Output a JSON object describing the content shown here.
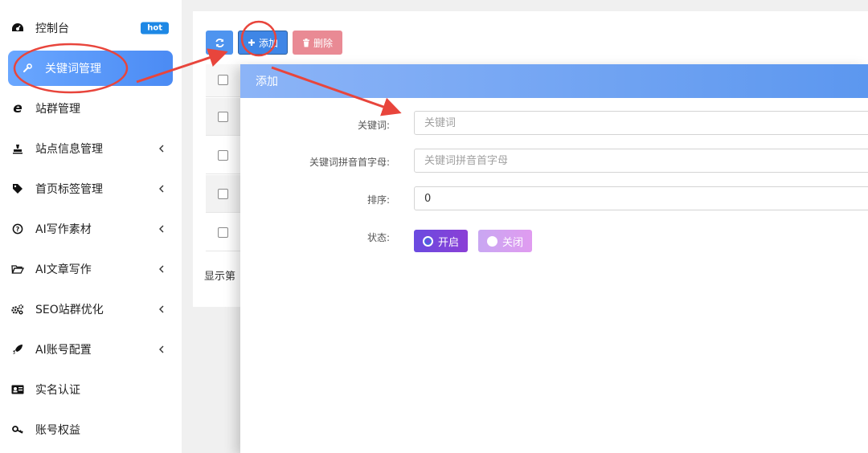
{
  "sidebar": {
    "items": [
      {
        "label": "控制台",
        "icon": "dashboard-icon",
        "badge": "hot"
      },
      {
        "label": "关键词管理",
        "icon": "wrench-icon",
        "active": true
      },
      {
        "label": "站群管理",
        "icon": "ie-icon"
      },
      {
        "label": "站点信息管理",
        "icon": "stamp-icon",
        "has_submenu": true
      },
      {
        "label": "首页标签管理",
        "icon": "tags-icon",
        "has_submenu": true
      },
      {
        "label": "AI写作素材",
        "icon": "question-circle-icon",
        "has_submenu": true
      },
      {
        "label": "AI文章写作",
        "icon": "folder-open-icon",
        "has_submenu": true
      },
      {
        "label": "SEO站群优化",
        "icon": "gears-icon",
        "has_submenu": true
      },
      {
        "label": "AI账号配置",
        "icon": "rocket-icon",
        "has_submenu": true
      },
      {
        "label": "实名认证",
        "icon": "id-card-icon"
      },
      {
        "label": "账号权益",
        "icon": "key-icon"
      }
    ]
  },
  "toolbar": {
    "add_label": "添加",
    "delete_label": "删除"
  },
  "table": {
    "footer_text": "显示第"
  },
  "modal": {
    "title": "添加",
    "fields": {
      "keyword": {
        "label": "关键词:",
        "placeholder": "关键词",
        "value": ""
      },
      "pinyin": {
        "label": "关键词拼音首字母:",
        "placeholder": "关键词拼音首字母",
        "value": ""
      },
      "sort": {
        "label": "排序:",
        "value": "0"
      },
      "status": {
        "label": "状态:",
        "options": [
          "开启",
          "关闭"
        ],
        "selected": "开启"
      }
    }
  },
  "colors": {
    "sidebar_active": "#4b8bf4",
    "modal_header": "#5c97ef",
    "status_on": "#6a4be0",
    "status_off": "#d9a2f2",
    "delete_button": "#e8848f",
    "annotation": "#e8453c"
  }
}
